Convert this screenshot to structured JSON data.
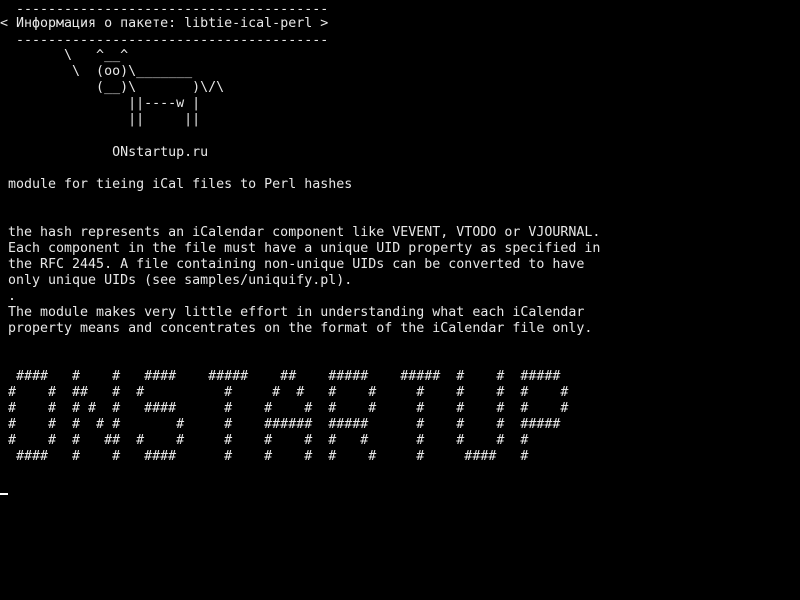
{
  "colors": {
    "background": "#000000",
    "foreground": "#e8e8e8",
    "cursor": "#ffffff"
  },
  "cowsay": {
    "bubble_top": " ---------------------------------------",
    "bubble_text": "< Информация о пакете: libtie-ical-perl >",
    "bubble_bottom": " ---------------------------------------",
    "cow_line_1": "       \\   ^__^",
    "cow_line_2": "        \\  (oo)\\_______",
    "cow_line_3": "           (__)\\       )\\/\\",
    "cow_line_4": "               ||----w |",
    "cow_line_5": "               ||     ||"
  },
  "site": "             ONstartup.ru",
  "package": {
    "summary": "module for tieing iCal files to Perl hashes",
    "desc_line_1": "the hash represents an iCalendar component like VEVENT, VTODO or VJOURNAL.",
    "desc_line_2": "Each component in the file must have a unique UID property as specified in",
    "desc_line_3": "the RFC 2445. A file containing non-unique UIDs can be converted to have",
    "desc_line_4": "only unique UIDs (see samples/uniquify.pl).",
    "desc_line_5": ".",
    "desc_line_6": "The module makes very little effort in understanding what each iCalendar",
    "desc_line_7": "property means and concentrates on the format of the iCalendar file only."
  },
  "banner": {
    "line_1": " ####   #    #   ####    #####    ##    #####    #####  #    #  #####",
    "line_2": "#    #  ##   #  #          #     #  #   #    #     #    #    #  #    #",
    "line_3": "#    #  # #  #   ####      #    #    #  #    #     #    #    #  #    #",
    "line_4": "#    #  #  # #       #     #    ######  #####      #    #    #  #####",
    "line_5": "#    #  #   ##  #    #     #    #    #  #   #      #    #    #  #",
    "line_6": " ####   #    #   ####      #    #    #  #    #     #     ####   #"
  }
}
